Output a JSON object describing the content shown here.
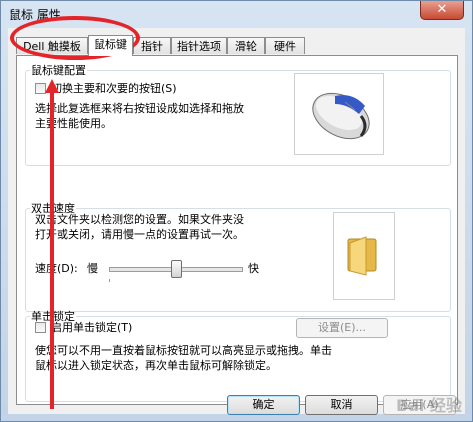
{
  "window": {
    "title": "鼠标 属性",
    "close_glyph": "✕"
  },
  "tabs": [
    {
      "label": "Dell 触摸板",
      "active": false
    },
    {
      "label": "鼠标键",
      "active": true
    },
    {
      "label": "指针",
      "active": false
    },
    {
      "label": "指针选项",
      "active": false
    },
    {
      "label": "滑轮",
      "active": false
    },
    {
      "label": "硬件",
      "active": false
    }
  ],
  "button_config": {
    "legend": "鼠标键配置",
    "switch_checkbox_label": "切换主要和次要的按钮(S)",
    "switch_checked": false,
    "description_line1": "选择此复选框来将右按钮设成如选择和拖放",
    "description_line2": "主要性能使用。",
    "image_icon": "mouse-icon"
  },
  "double_click": {
    "legend": "双击速度",
    "description_line1": "双击文件夹以检测您的设置。如果文件夹没",
    "description_line2": "打开或关闭，请用慢一点的设置再试一次。",
    "speed_label": "速度(D):",
    "slow_label": "慢",
    "fast_label": "快",
    "speed_value_fraction": 0.5,
    "image_icon": "folder-icon"
  },
  "click_lock": {
    "legend": "单击锁定",
    "checkbox_label": "启用单击锁定(T)",
    "checked": false,
    "settings_button": "设置(E)...",
    "description_line1": "使您可以不用一直按着鼠标按钮就可以高亮显示或拖拽。单击",
    "description_line2": "鼠标以进入锁定状态，再次单击鼠标可解除锁定。"
  },
  "footer": {
    "ok": "确定",
    "cancel": "取消",
    "apply": "应用(A)"
  },
  "annotations": {
    "color": "#e3252a"
  },
  "watermark": "Bai 经验"
}
